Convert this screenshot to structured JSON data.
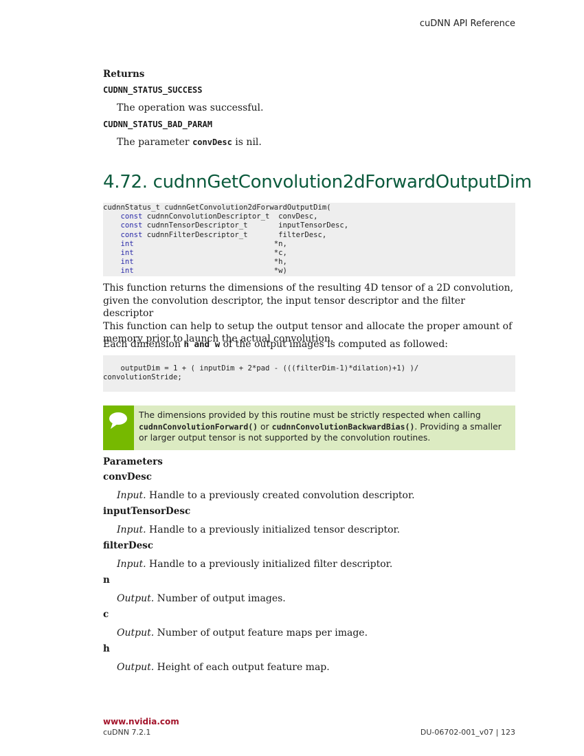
{
  "header": {
    "title": "cuDNN API Reference"
  },
  "returns": {
    "heading": "Returns",
    "items": [
      {
        "code": "CUDNN_STATUS_SUCCESS",
        "desc": "The operation was successful."
      },
      {
        "code": "CUDNN_STATUS_BAD_PARAM",
        "desc_pre": "The parameter ",
        "desc_code": "convDesc",
        "desc_post": " is nil."
      }
    ]
  },
  "section": {
    "title": "4.72. cudnnGetConvolution2dForwardOutputDim"
  },
  "signature": {
    "head": "cudnnStatus_t cudnnGetConvolution2dForwardOutputDim(",
    "params": [
      {
        "kw": "const",
        "rest": " cudnnConvolutionDescriptor_t  convDesc,"
      },
      {
        "kw": "const",
        "rest": " cudnnTensorDescriptor_t       inputTensorDesc,"
      },
      {
        "kw": "const",
        "rest": " cudnnFilterDescriptor_t       filterDesc,"
      },
      {
        "kw": "int",
        "rest": "                                *n,"
      },
      {
        "kw": "int",
        "rest": "                                *c,"
      },
      {
        "kw": "int",
        "rest": "                                *h,"
      },
      {
        "kw": "int",
        "rest": "                                *w)"
      }
    ]
  },
  "description": {
    "p1_lines": [
      "This function returns the dimensions of the resulting 4D tensor of a 2D convolution,",
      "given the convolution descriptor, the input tensor descriptor and the filter descriptor",
      "This function can help to setup the output tensor and allocate the proper amount of",
      "memory prior to launch the actual convolution."
    ],
    "p2_pre": "Each dimension ",
    "p2_code": "h and w",
    "p2_post": " of the output images is computed as followed:"
  },
  "formula": {
    "line1": "    outputDim = 1 + ( inputDim + 2*pad - (((filterDim-1)*dilation)+1) )/",
    "line2": "convolutionStride;"
  },
  "note": {
    "text_pre": "The dimensions provided by this routine must be strictly respected when calling ",
    "code1": "cudnnConvolutionForward()",
    "mid": " or ",
    "code2": "cudnnConvolutionBackwardBias()",
    "text_post": ". Providing a smaller or larger output tensor is not supported by the convolution routines.",
    "icon": "speech-bubble-icon"
  },
  "parameters": {
    "heading": "Parameters",
    "items": [
      {
        "name": "convDesc",
        "kind": "Input.",
        "desc": " Handle to a previously created convolution descriptor."
      },
      {
        "name": "inputTensorDesc",
        "kind": "Input.",
        "desc": " Handle to a previously initialized tensor descriptor."
      },
      {
        "name": "filterDesc",
        "kind": "Input.",
        "desc": " Handle to a previously initialized filter descriptor."
      },
      {
        "name": "n",
        "kind": "Output.",
        "desc": " Number of output images."
      },
      {
        "name": "c",
        "kind": "Output.",
        "desc": " Number of output feature maps per image."
      },
      {
        "name": "h",
        "kind": "Output.",
        "desc": " Height of each output feature map."
      }
    ]
  },
  "footer": {
    "link": "www.nvidia.com",
    "product": "cuDNN 7.2.1",
    "doc_id": "DU-06702-001_v07  |  123"
  },
  "colors": {
    "accent_green": "#76b900",
    "title_green": "#0b5a3c",
    "link_red": "#a3132a"
  }
}
